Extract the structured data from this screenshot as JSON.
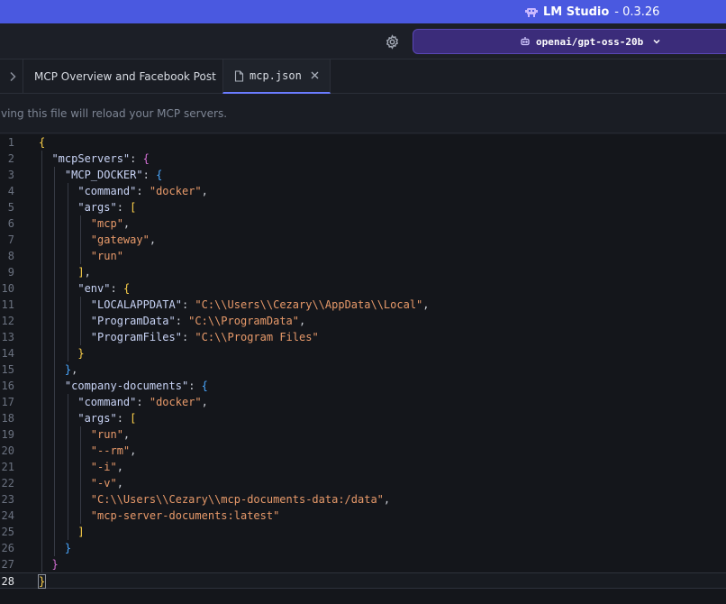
{
  "titlebar": {
    "app_name": "LM Studio",
    "version_text": " - 0.3.26",
    "logo_icon": "lmstudio-logo-icon"
  },
  "toolbar": {
    "settings_icon": "gear-icon",
    "model_label": "openai/gpt-oss-20b",
    "model_icon": "robot-icon"
  },
  "tabs": [
    {
      "label": "MCP Overview and Facebook Post",
      "more": "···"
    },
    {
      "label": "mcp.json",
      "active": true
    }
  ],
  "info_text": "Saving this file will reload your MCP servers.",
  "editor": {
    "current_line": 28,
    "lines": [
      {
        "n": "1"
      },
      {
        "n": "2"
      },
      {
        "n": "3"
      },
      {
        "n": "4"
      },
      {
        "n": "5"
      },
      {
        "n": "6"
      },
      {
        "n": "7"
      },
      {
        "n": "8"
      },
      {
        "n": "9"
      },
      {
        "n": "10"
      },
      {
        "n": "11"
      },
      {
        "n": "12"
      },
      {
        "n": "13"
      },
      {
        "n": "14"
      },
      {
        "n": "15"
      },
      {
        "n": "16"
      },
      {
        "n": "17"
      },
      {
        "n": "18"
      },
      {
        "n": "19"
      },
      {
        "n": "20"
      },
      {
        "n": "21"
      },
      {
        "n": "22"
      },
      {
        "n": "23"
      },
      {
        "n": "24"
      },
      {
        "n": "25"
      },
      {
        "n": "26"
      },
      {
        "n": "27"
      },
      {
        "n": "28"
      }
    ],
    "code": {
      "k_mcpServers": "\"mcpServers\"",
      "k_mcp_docker": "\"MCP_DOCKER\"",
      "k_command": "\"command\"",
      "v_docker": "\"docker\"",
      "k_args": "\"args\"",
      "v_mcp": "\"mcp\"",
      "v_gateway": "\"gateway\"",
      "v_run": "\"run\"",
      "k_env": "\"env\"",
      "k_localappdata": "\"LOCALAPPDATA\"",
      "v_localappdata": "\"C:\\\\Users\\\\Cezary\\\\AppData\\\\Local\"",
      "k_programdata": "\"ProgramData\"",
      "v_programdata": "\"C:\\\\ProgramData\"",
      "k_programfiles": "\"ProgramFiles\"",
      "v_programfiles": "\"C:\\\\Program Files\"",
      "k_company_documents": "\"company-documents\"",
      "v_rm": "\"--rm\"",
      "v_i": "\"-i\"",
      "v_v": "\"-v\"",
      "v_volume": "\"C:\\\\Users\\\\Cezary\\\\mcp-documents-data:/data\"",
      "v_image": "\"mcp-server-documents:latest\""
    }
  },
  "colors": {
    "titlebar": "#4a59e0",
    "model_button": "#3b2c7a",
    "key": "#c8d3f5",
    "string": "#e89a6a",
    "brace_1": "#ffd24a",
    "brace_2": "#d670d6",
    "brace_3": "#4aa8ff"
  }
}
